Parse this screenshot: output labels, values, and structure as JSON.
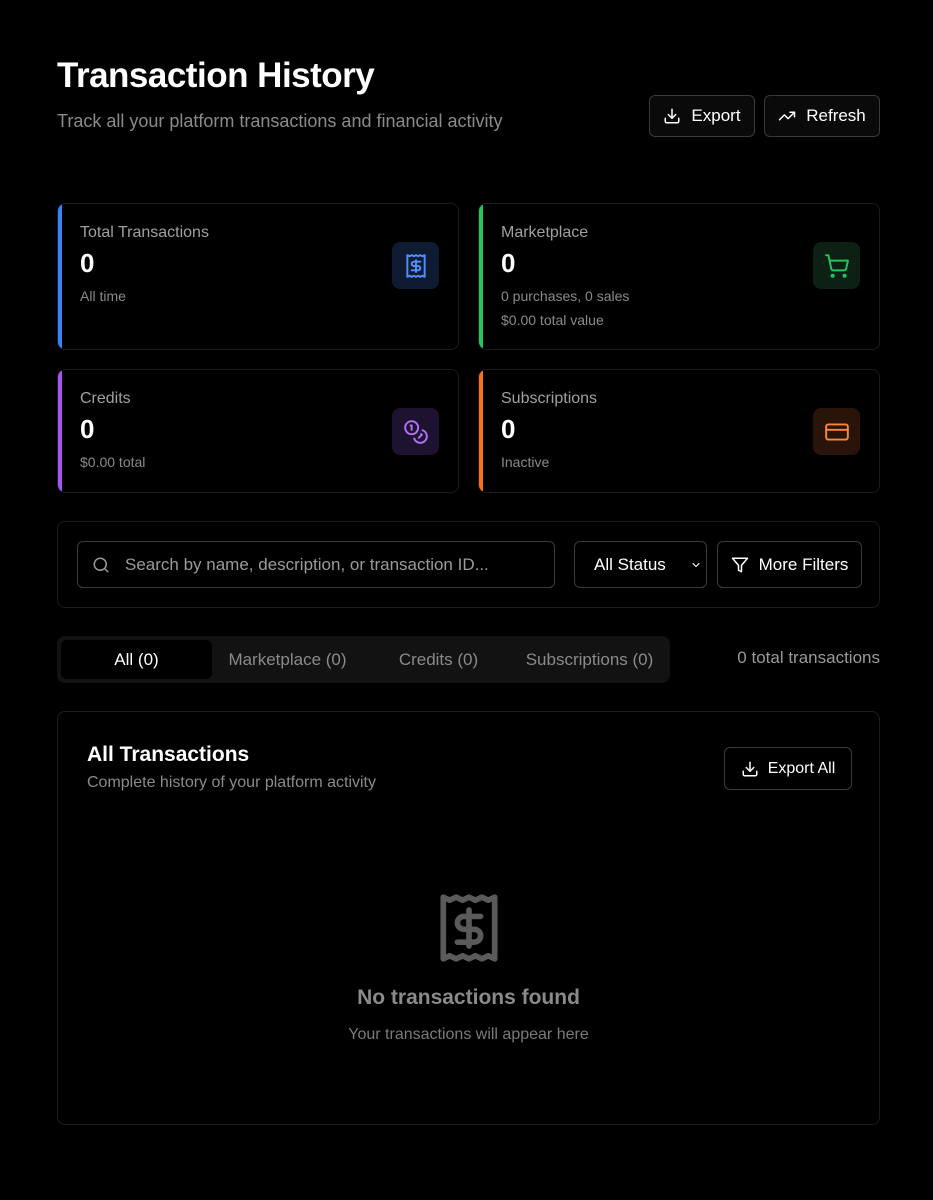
{
  "header": {
    "title": "Transaction History",
    "subtitle": "Track all your platform transactions and financial activity",
    "export_label": "Export",
    "refresh_label": "Refresh"
  },
  "stats": [
    {
      "label": "Total Transactions",
      "value": "0",
      "sub1": "All time",
      "sub2": "",
      "accent": "#3b82f6",
      "icon": "receipt-dollar-icon"
    },
    {
      "label": "Marketplace",
      "value": "0",
      "sub1": "0 purchases, 0 sales",
      "sub2": "$0.00 total value",
      "accent": "#22c55e",
      "icon": "shopping-cart-icon"
    },
    {
      "label": "Credits",
      "value": "0",
      "sub1": "$0.00 total",
      "sub2": "",
      "accent": "#a855f7",
      "icon": "coins-icon"
    },
    {
      "label": "Subscriptions",
      "value": "0",
      "sub1": "Inactive",
      "sub2": "",
      "accent": "#f97316",
      "icon": "credit-card-icon"
    }
  ],
  "filters": {
    "search_placeholder": "Search by name, description, or transaction ID...",
    "status_selected": "All Status",
    "more_filters_label": "More Filters"
  },
  "tabs": [
    {
      "label": "All (0)",
      "active": true
    },
    {
      "label": "Marketplace (0)",
      "active": false
    },
    {
      "label": "Credits (0)",
      "active": false
    },
    {
      "label": "Subscriptions (0)",
      "active": false
    }
  ],
  "total_count": "0 total transactions",
  "panel": {
    "title": "All Transactions",
    "subtitle": "Complete history of your platform activity",
    "export_all_label": "Export All",
    "empty_title": "No transactions found",
    "empty_subtitle": "Your transactions will appear here"
  }
}
